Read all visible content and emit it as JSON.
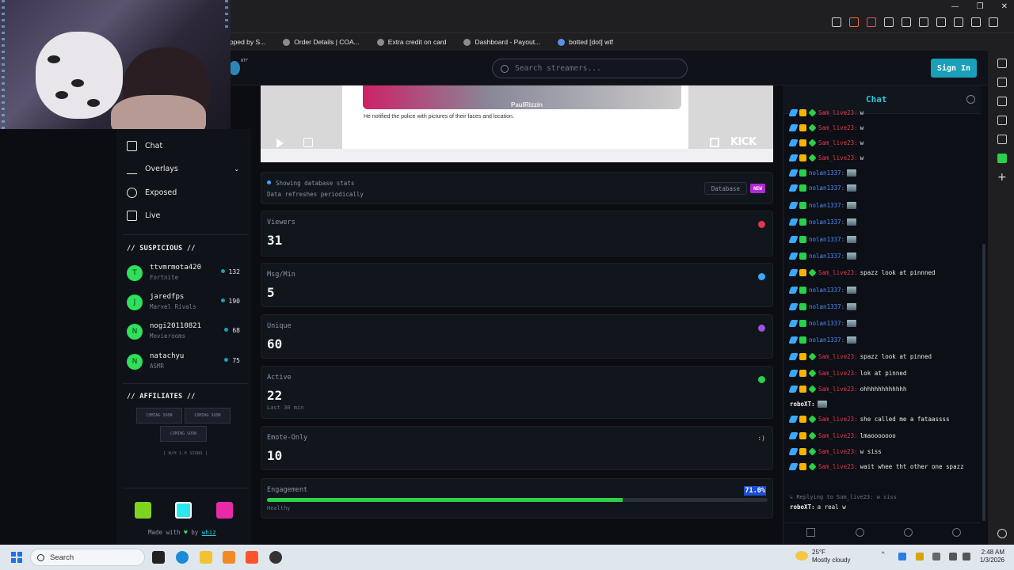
{
  "browser": {
    "bookmarks": [
      {
        "label": "ipped by S..."
      },
      {
        "label": "Order Details | COA..."
      },
      {
        "label": "Extra credit on card"
      },
      {
        "label": "Dashboard - Payout..."
      },
      {
        "label": "botted [dot] wtf"
      }
    ],
    "window_controls": [
      "—",
      "❐",
      "✕"
    ]
  },
  "header": {
    "logo_sup": "WTF",
    "search_placeholder": "Search streamers...",
    "signin_label": "Sign In"
  },
  "sidebar": {
    "nav": [
      {
        "label": "Chat",
        "icon": "chat-icon"
      },
      {
        "label": "Overlays",
        "icon": "overlays-icon"
      },
      {
        "label": "Exposed",
        "icon": "eye-icon"
      },
      {
        "label": "Live",
        "icon": "tv-icon"
      }
    ],
    "suspicious_title": "// SUSPICIOUS //",
    "suspicious": [
      {
        "initial": "T",
        "name": "ttvmrmota420",
        "category": "Fortnite",
        "count": "132"
      },
      {
        "initial": "J",
        "name": "jaredfps",
        "category": "Marvel Rivals",
        "count": "190"
      },
      {
        "initial": "N",
        "name": "nogi20110821",
        "category": "Movierooms",
        "count": "68"
      },
      {
        "initial": "N",
        "name": "natachyu",
        "category": "ASMR",
        "count": "75"
      }
    ],
    "affiliates_title": "// AFFILIATES //",
    "affiliates": [
      "COMING SOON",
      "COMING SOON",
      "COMING SOON"
    ],
    "affiliates_note": "[ W/H 1.0 SIGNS ]",
    "swatches": [
      "#7ed321",
      "#2ce6f0",
      "#e82aa8"
    ],
    "made_with": "Made with",
    "heart": "♥",
    "by": "by",
    "author": "whiz"
  },
  "video": {
    "caption": "He notified the police with pictures of their faces and location.",
    "overlay_name": "PaulRizzin",
    "brand": "KICK"
  },
  "stats": {
    "db_status": "Showing database stats",
    "db_note": "Data refreshes periodically",
    "db_button": "Database",
    "new_badge": "NEW",
    "cards": [
      {
        "label": "Viewers",
        "value": "31",
        "sub": "",
        "icon": "eye-icon",
        "color": "#e2384b"
      },
      {
        "label": "Msg/Min",
        "value": "5",
        "sub": "",
        "icon": "message-icon",
        "color": "#3aa8ff"
      },
      {
        "label": "Unique",
        "value": "60",
        "sub": "",
        "icon": "users-icon",
        "color": "#a050e0"
      },
      {
        "label": "Active",
        "value": "22",
        "sub": "Last 30 min",
        "icon": "check-icon",
        "color": "#2ad14a"
      },
      {
        "label": "Emote-Only",
        "value": "10",
        "sub": "",
        "icon": "smile-icon",
        "color": "#f4d03f"
      }
    ],
    "engagement": {
      "label": "Engagement",
      "percent": "71.0%",
      "fraction": 0.71,
      "status": "Healthy"
    }
  },
  "chat": {
    "title": "Chat",
    "messages": [
      {
        "user": "Sam_live23:",
        "text": "w",
        "style": "red",
        "badges": [
          "sw",
          "cr",
          "gm"
        ]
      },
      {
        "user": "Sam_live23:",
        "text": "w",
        "style": "red",
        "badges": [
          "sw",
          "cr",
          "gm"
        ]
      },
      {
        "user": "Sam_live23:",
        "text": "w",
        "style": "red",
        "badges": [
          "sw",
          "cr",
          "gm"
        ]
      },
      {
        "user": "Sam_live23:",
        "text": "w",
        "style": "red",
        "badges": [
          "sw",
          "cr",
          "gm"
        ]
      },
      {
        "user": "nolan1337:",
        "text": "",
        "style": "blue",
        "badges": [
          "sw",
          "bt"
        ],
        "emote": true
      },
      {
        "user": "nolan1337:",
        "text": "",
        "style": "blue",
        "badges": [
          "sw",
          "bt"
        ],
        "emote": true
      },
      {
        "user": "nolan1337:",
        "text": "",
        "style": "blue",
        "badges": [
          "sw",
          "bt"
        ],
        "emote": true
      },
      {
        "user": "nolan1337:",
        "text": "",
        "style": "blue",
        "badges": [
          "sw",
          "bt"
        ],
        "emote": true
      },
      {
        "user": "nolan1337:",
        "text": "",
        "style": "blue",
        "badges": [
          "sw",
          "bt"
        ],
        "emote": true
      },
      {
        "user": "nolan1337:",
        "text": "",
        "style": "blue",
        "badges": [
          "sw",
          "bt"
        ],
        "emote": true
      },
      {
        "user": "Sam_live23:",
        "text": "spazz look at pinnned",
        "style": "red",
        "badges": [
          "sw",
          "cr",
          "gm"
        ]
      },
      {
        "user": "nolan1337:",
        "text": "",
        "style": "blue",
        "badges": [
          "sw",
          "bt"
        ],
        "emote": true
      },
      {
        "user": "nolan1337:",
        "text": "",
        "style": "blue",
        "badges": [
          "sw",
          "bt"
        ],
        "emote": true
      },
      {
        "user": "nolan1337:",
        "text": "",
        "style": "blue",
        "badges": [
          "sw",
          "bt"
        ],
        "emote": true
      },
      {
        "user": "nolan1337:",
        "text": "",
        "style": "blue",
        "badges": [
          "sw",
          "bt"
        ],
        "emote": true
      },
      {
        "user": "Sam_live23:",
        "text": "spazz look at pinned",
        "style": "red",
        "badges": [
          "sw",
          "cr",
          "gm"
        ]
      },
      {
        "user": "Sam_live23:",
        "text": "lok at pinned",
        "style": "red",
        "badges": [
          "sw",
          "cr",
          "gm"
        ]
      },
      {
        "user": "Sam_live23:",
        "text": "ohhhhhhhhhhhh",
        "style": "red",
        "badges": [
          "sw",
          "cr",
          "gm"
        ]
      },
      {
        "user": "roboXT:",
        "text": "",
        "style": "white",
        "badges": [],
        "emote": true
      },
      {
        "user": "Sam_live23:",
        "text": "she called me a fataassss",
        "style": "red",
        "badges": [
          "sw",
          "cr",
          "gm"
        ]
      },
      {
        "user": "Sam_live23:",
        "text": "lmaooooooo",
        "style": "red",
        "badges": [
          "sw",
          "cr",
          "gm"
        ]
      },
      {
        "user": "Sam_live23:",
        "text": "w siss",
        "style": "red",
        "badges": [
          "sw",
          "cr",
          "gm"
        ]
      },
      {
        "user": "Sam_live23:",
        "text": "wait whee tht other one spazz",
        "style": "red",
        "badges": [
          "sw",
          "cr",
          "gm"
        ]
      }
    ],
    "reply_context": "↳ Replying to Sam_live23: w siss",
    "last_message": {
      "user": "roboXT:",
      "text": "a real w"
    }
  },
  "taskbar": {
    "search_label": "Search",
    "weather_temp": "25°F",
    "weather_desc": "Mostly cloudy",
    "time": "2:48 AM",
    "date": "1/3/2026"
  }
}
